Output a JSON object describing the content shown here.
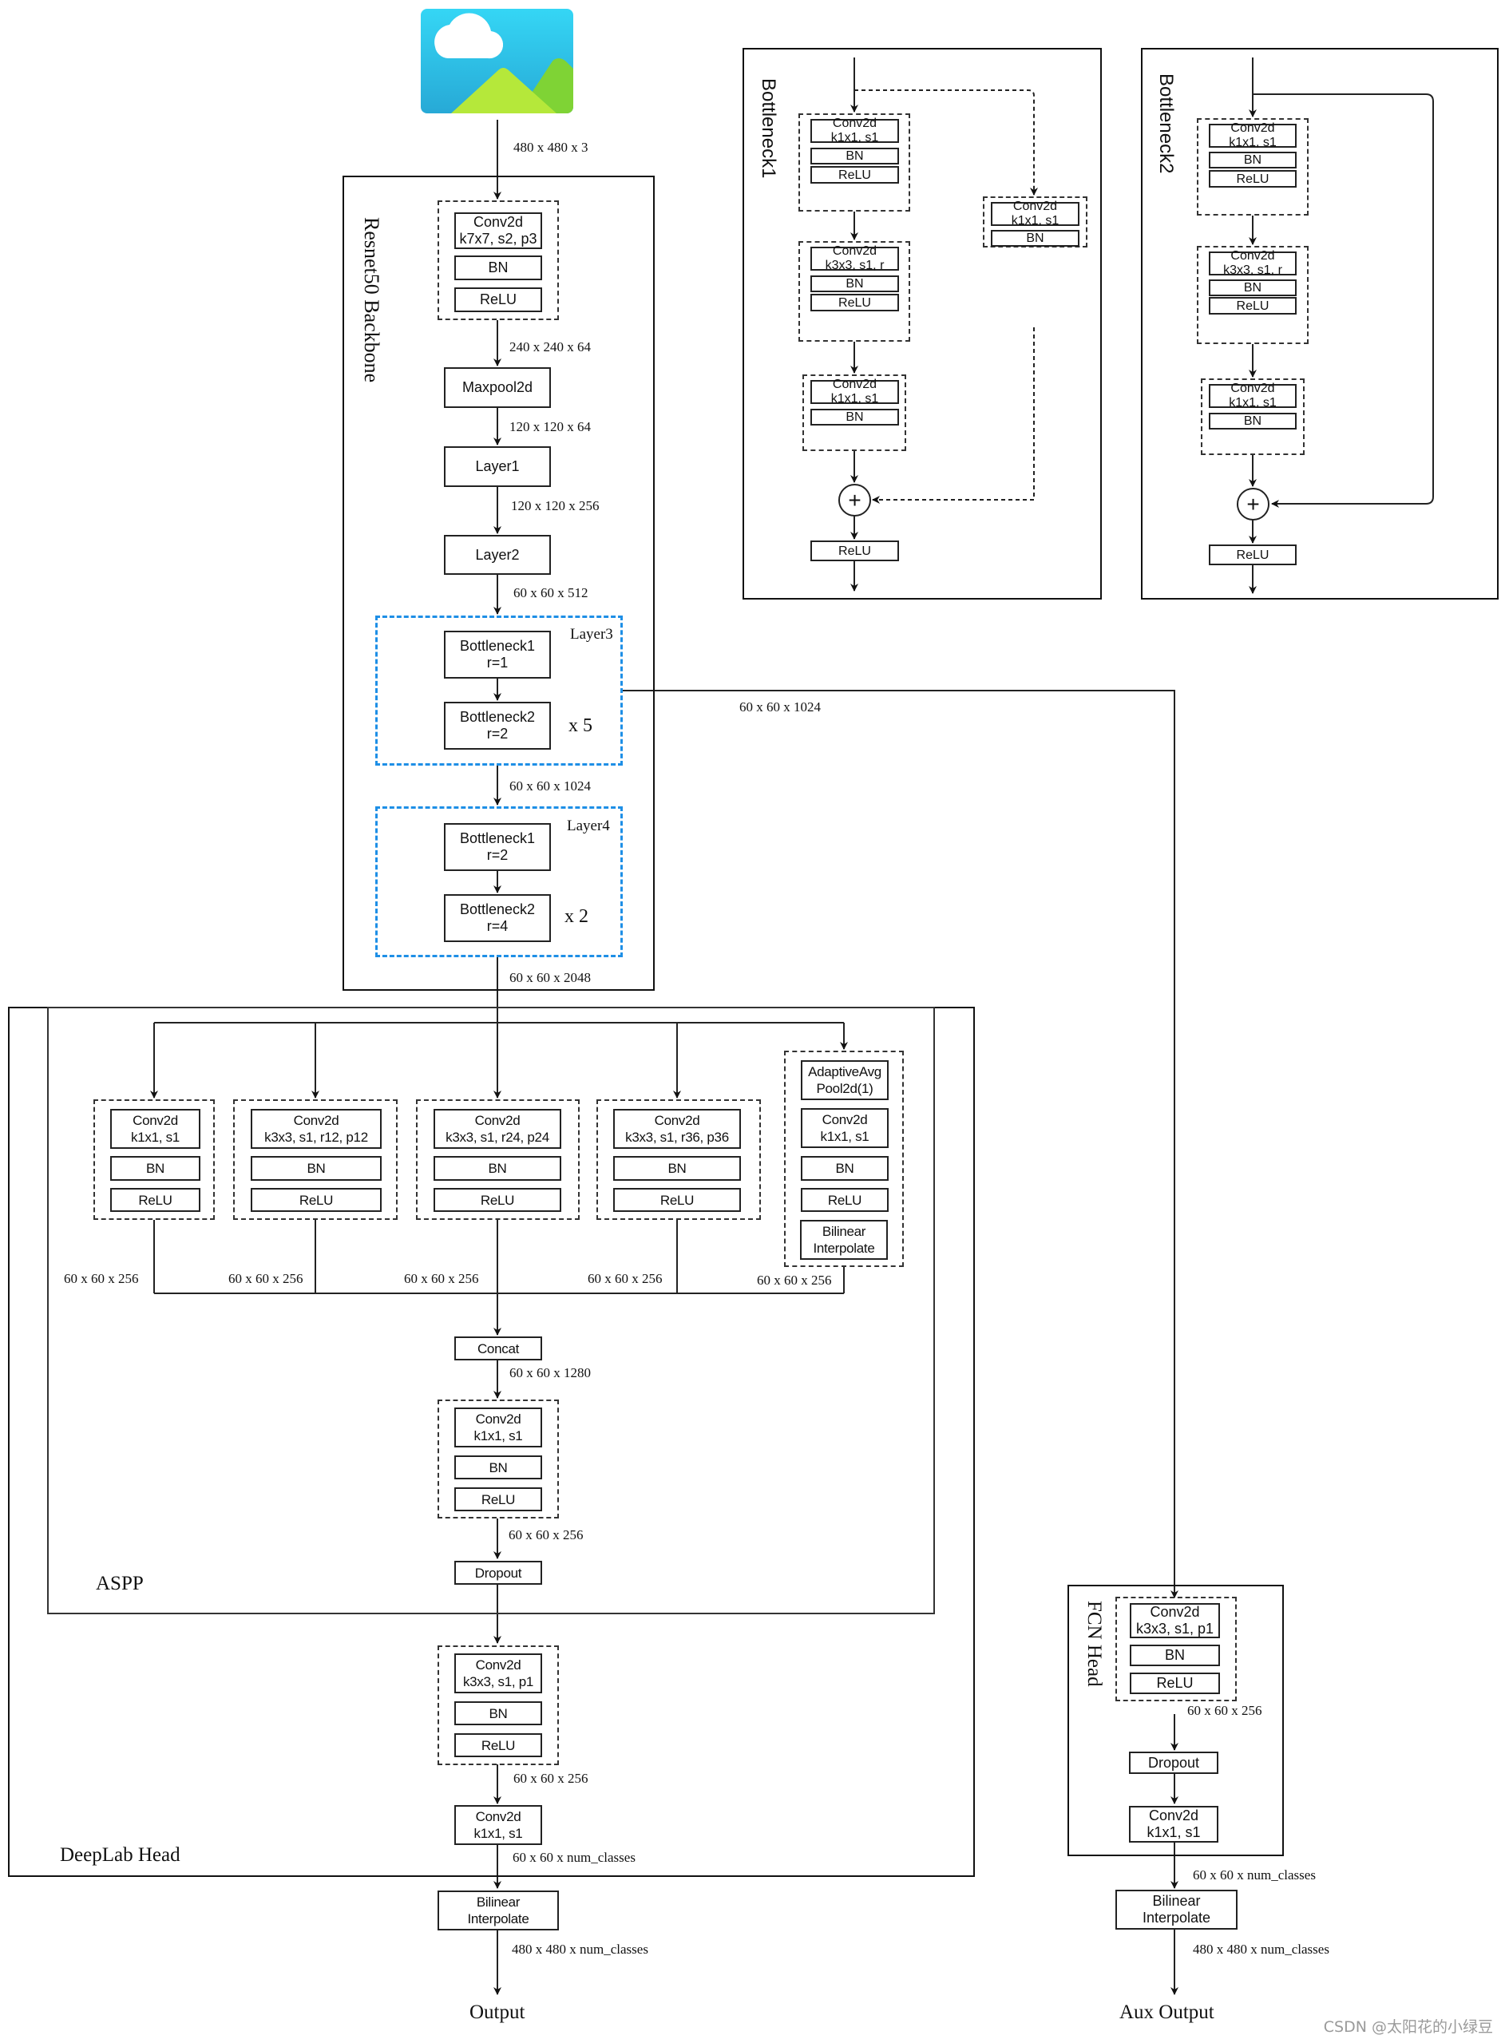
{
  "input_image": {
    "icon": "landscape-image-icon",
    "colors": {
      "sky_top": "#35d6f5",
      "sky_bottom": "#27a9d6",
      "cloud": "#ffffff",
      "hill_front": "#b5e83a",
      "hill_back": "#7fd335"
    }
  },
  "backbone": {
    "title": "Resnet50 Backbone",
    "stem": {
      "conv": "Conv2d\nk7x7, s2, p3",
      "bn": "BN",
      "relu": "ReLU"
    },
    "maxpool": "Maxpool2d",
    "layer1": "Layer1",
    "layer2": "Layer2",
    "layer3": {
      "title": "Layer3",
      "b1": "Bottleneck1\nr=1",
      "b2": "Bottleneck2\nr=2",
      "repeat": "x 5"
    },
    "layer4": {
      "title": "Layer4",
      "b1": "Bottleneck1\nr=2",
      "b2": "Bottleneck2\nr=4",
      "repeat": "x 2"
    },
    "dims": {
      "input": "480 x 480 x 3",
      "stem_out": "240 x 240 x 64",
      "maxpool_out": "120 x 120 x 64",
      "layer1_out": "120 x 120 x 256",
      "layer2_out": "60 x 60 x 512",
      "layer3_out": "60 x 60 x 1024",
      "layer3_aux": "60 x 60 x 1024",
      "layer4_out": "60 x 60 x 2048"
    },
    "accent_color": "#1e8fe6"
  },
  "bottleneck1": {
    "title": "Bottleneck1",
    "block1": {
      "conv": "Conv2d\nk1x1, s1",
      "bn": "BN",
      "relu": "ReLU"
    },
    "block2": {
      "conv": "Conv2d\nk3x3, s1, r",
      "bn": "BN",
      "relu": "ReLU"
    },
    "block3": {
      "conv": "Conv2d\nk1x1, s1",
      "bn": "BN"
    },
    "shortcut": {
      "conv": "Conv2d\nk1x1, s1",
      "bn": "BN"
    },
    "add": "+",
    "relu": "ReLU"
  },
  "bottleneck2": {
    "title": "Bottleneck2",
    "block1": {
      "conv": "Conv2d\nk1x1, s1",
      "bn": "BN",
      "relu": "ReLU"
    },
    "block2": {
      "conv": "Conv2d\nk3x3, s1, r",
      "bn": "BN",
      "relu": "ReLU"
    },
    "block3": {
      "conv": "Conv2d\nk1x1, s1",
      "bn": "BN"
    },
    "add": "+",
    "relu": "ReLU"
  },
  "aspp": {
    "title": "ASPP",
    "branches": [
      {
        "conv": "Conv2d\nk1x1, s1",
        "bn": "BN",
        "relu": "ReLU",
        "out": "60 x 60 x 256"
      },
      {
        "conv": "Conv2d\nk3x3, s1, r12, p12",
        "bn": "BN",
        "relu": "ReLU",
        "out": "60 x 60 x 256"
      },
      {
        "conv": "Conv2d\nk3x3, s1, r24, p24",
        "bn": "BN",
        "relu": "ReLU",
        "out": "60 x 60 x 256"
      },
      {
        "conv": "Conv2d\nk3x3, s1, r36, p36",
        "bn": "BN",
        "relu": "ReLU",
        "out": "60 x 60 x 256"
      }
    ],
    "pool_branch": {
      "pool": "AdaptiveAvg\nPool2d(1)",
      "conv": "Conv2d\nk1x1, s1",
      "bn": "BN",
      "relu": "ReLU",
      "interp": "Bilinear\nInterpolate",
      "out": "60 x 60 x 256"
    },
    "concat": "Concat",
    "concat_out": "60 x 60 x 1280",
    "project": {
      "conv": "Conv2d\nk1x1, s1",
      "bn": "BN",
      "relu": "ReLU"
    },
    "project_out": "60 x 60 x 256",
    "dropout": "Dropout"
  },
  "deeplab_head": {
    "title": "DeepLab Head",
    "conv_block": {
      "conv": "Conv2d\nk3x3, s1, p1",
      "bn": "BN",
      "relu": "ReLU"
    },
    "conv_block_out": "60 x 60 x 256",
    "classifier": "Conv2d\nk1x1, s1",
    "classifier_out": "60 x 60 x num_classes"
  },
  "main_output": {
    "interp": "Bilinear\nInterpolate",
    "interp_out": "480 x 480 x num_classes",
    "label": "Output"
  },
  "fcn_head": {
    "title": "FCN Head",
    "conv_block": {
      "conv": "Conv2d\nk3x3, s1, p1",
      "bn": "BN",
      "relu": "ReLU"
    },
    "conv_block_out": "60 x 60 x 256",
    "dropout": "Dropout",
    "classifier": "Conv2d\nk1x1, s1",
    "classifier_out": "60 x 60 x num_classes"
  },
  "aux_output": {
    "interp": "Bilinear\nInterpolate",
    "interp_out": "480 x 480 x num_classes",
    "label": "Aux Output"
  },
  "watermark": "CSDN @太阳花的小绿豆"
}
